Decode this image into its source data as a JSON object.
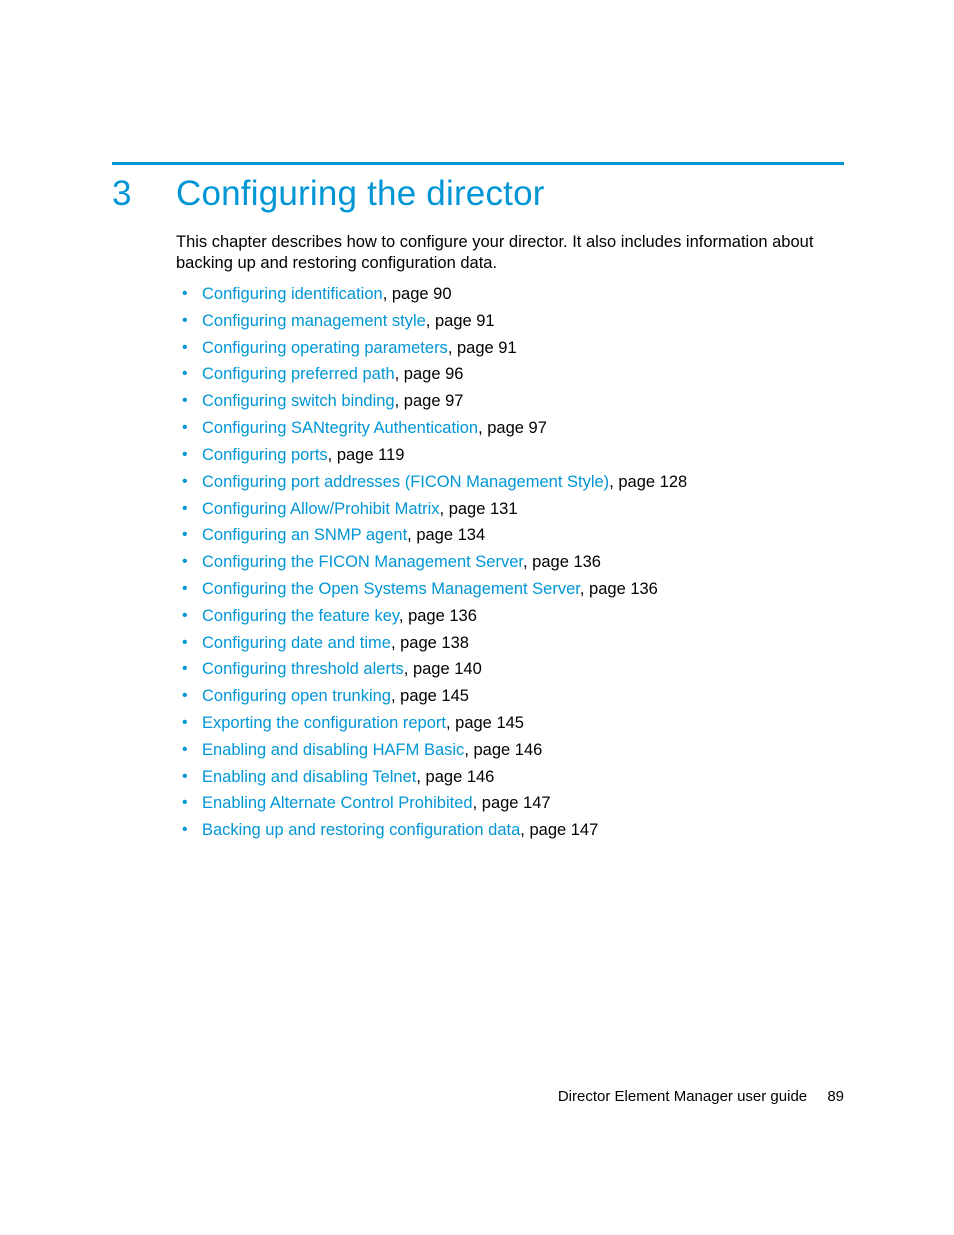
{
  "chapter_number": "3",
  "chapter_title": "Configuring the director",
  "intro_text": "This chapter describes how to configure your director. It also includes information about backing up and restoring configuration data.",
  "toc": [
    {
      "link": "Configuring identification",
      "suffix": ", page 90"
    },
    {
      "link": "Configuring management style",
      "suffix": ", page 91"
    },
    {
      "link": "Configuring operating parameters",
      "suffix": ", page 91"
    },
    {
      "link": "Configuring preferred path",
      "suffix": ", page 96"
    },
    {
      "link": "Configuring switch binding",
      "suffix": ", page 97"
    },
    {
      "link": "Configuring SANtegrity Authentication",
      "suffix": ", page 97"
    },
    {
      "link": "Configuring ports",
      "suffix": ", page 119"
    },
    {
      "link": "Configuring port addresses (FICON Management Style)",
      "suffix": ", page 128"
    },
    {
      "link": "Configuring Allow/Prohibit Matrix",
      "suffix": ", page 131"
    },
    {
      "link": "Configuring an SNMP agent",
      "suffix": ", page 134"
    },
    {
      "link": "Configuring the FICON Management Server",
      "suffix": ", page 136"
    },
    {
      "link": "Configuring the Open Systems Management Server",
      "suffix": ", page 136"
    },
    {
      "link": "Configuring the feature key",
      "suffix": ", page 136"
    },
    {
      "link": "Configuring date and time",
      "suffix": ", page 138"
    },
    {
      "link": "Configuring threshold alerts",
      "suffix": ", page 140"
    },
    {
      "link": "Configuring open trunking",
      "suffix": ", page 145"
    },
    {
      "link": "Exporting the configuration report",
      "suffix": ", page 145"
    },
    {
      "link": "Enabling and disabling HAFM Basic",
      "suffix": ", page 146"
    },
    {
      "link": "Enabling and disabling Telnet",
      "suffix": ", page 146"
    },
    {
      "link": "Enabling Alternate Control Prohibited",
      "suffix": ", page 147"
    },
    {
      "link": "Backing up and restoring configuration data",
      "suffix": ", page 147"
    }
  ],
  "footer_text": "Director Element Manager user guide",
  "page_number": "89"
}
